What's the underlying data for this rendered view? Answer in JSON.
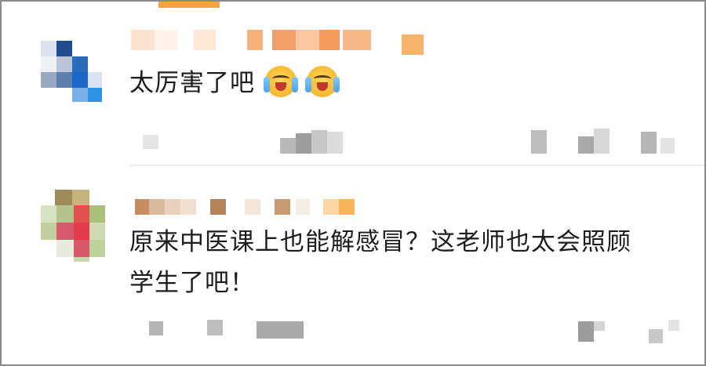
{
  "comments": [
    {
      "text": "太厉害了吧",
      "emojis": [
        "crying-laughing-emoji",
        "crying-laughing-emoji"
      ]
    },
    {
      "text_line1": "原来中医课上也能解感冒？这老师也太会照顾",
      "text_line2": "学生了吧！"
    }
  ],
  "colors": {
    "text": "#1d1d1d",
    "accent": "#f7a346",
    "border": "#8a8a8a",
    "pixelated_gray": "#cfcfcf"
  }
}
